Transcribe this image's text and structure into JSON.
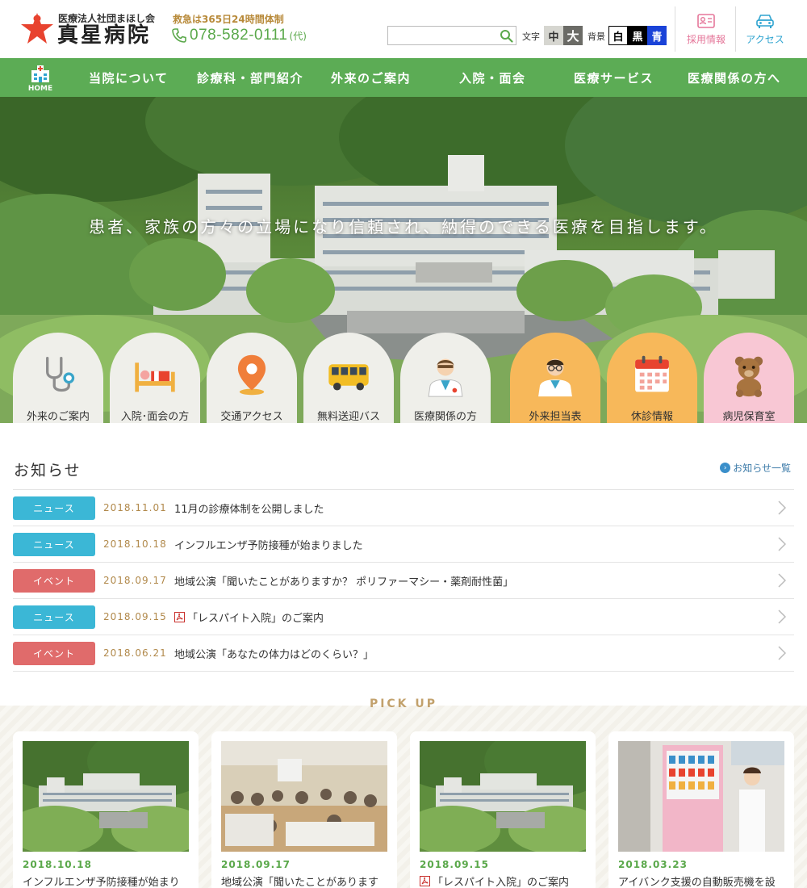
{
  "header": {
    "corporation": "医療法人社団まほし会",
    "hospital_name": "真星病院",
    "emergency": "救急は365日24時間体制",
    "phone": "078-582-0111",
    "phone_suffix": "(代)",
    "search_placeholder": "",
    "font_label": "文字",
    "font_mid": "中",
    "font_large": "大",
    "bg_label": "背景",
    "bg_white": "白",
    "bg_black": "黒",
    "bg_blue": "青",
    "recruit": "採用情報",
    "access": "アクセス"
  },
  "nav": {
    "home": "HOME",
    "items": [
      "当院について",
      "診療科・部門紹介",
      "外来のご案内",
      "入院・面会",
      "医療サービス",
      "医療関係の方へ"
    ]
  },
  "hero": {
    "tagline": "患者、家族の方々の立場になり信頼され、納得のできる医療を目指します。"
  },
  "quick_links": [
    {
      "label": "外来のご案内",
      "icon": "stethoscope-icon"
    },
    {
      "label": "入院･面会の方",
      "icon": "hospital-bed-icon"
    },
    {
      "label": "交通アクセス",
      "icon": "map-pin-icon"
    },
    {
      "label": "無料送迎バス",
      "icon": "bus-icon"
    },
    {
      "label": "医療関係の方",
      "icon": "doctor-icon"
    },
    {
      "label": "外来担当表",
      "icon": "doctor-glasses-icon"
    },
    {
      "label": "休診情報",
      "icon": "calendar-icon"
    },
    {
      "label": "病児保育室",
      "icon": "teddy-bear-icon"
    }
  ],
  "news": {
    "title": "お知らせ",
    "all_link": "お知らせ一覧",
    "items": [
      {
        "category": "ニュース",
        "date": "2018.11.01",
        "title": "11月の診療体制を公開しました"
      },
      {
        "category": "ニュース",
        "date": "2018.10.18",
        "title": "インフルエンザ予防接種が始まりました"
      },
      {
        "category": "イベント",
        "date": "2018.09.17",
        "title": "地域公演「聞いたことがありますか？ ポリファーマシー・薬剤耐性菌」"
      },
      {
        "category": "ニュース",
        "date": "2018.09.15",
        "title": "「レスパイト入院」のご案内"
      },
      {
        "category": "イベント",
        "date": "2018.06.21",
        "title": "地域公演「あなたの体力はどのくらい？」"
      }
    ]
  },
  "pickup": {
    "title": "PICK UP",
    "cards": [
      {
        "date": "2018.10.18",
        "title": "インフルエンザ予防接種が始まり"
      },
      {
        "date": "2018.09.17",
        "title": "地域公演「聞いたことがあります"
      },
      {
        "date": "2018.09.15",
        "title": "「レスパイト入院」のご案内"
      },
      {
        "date": "2018.03.23",
        "title": "アイバンク支援の自動販売機を設"
      }
    ]
  },
  "colors": {
    "nav_green": "#5cac55",
    "news_badge": "#3bb7d6",
    "event_badge": "#e06b6b",
    "accent_gold": "#b1894b",
    "quick_grey": "#efefea",
    "quick_orange": "#f7b85a",
    "quick_pink": "#f8c7d4"
  }
}
